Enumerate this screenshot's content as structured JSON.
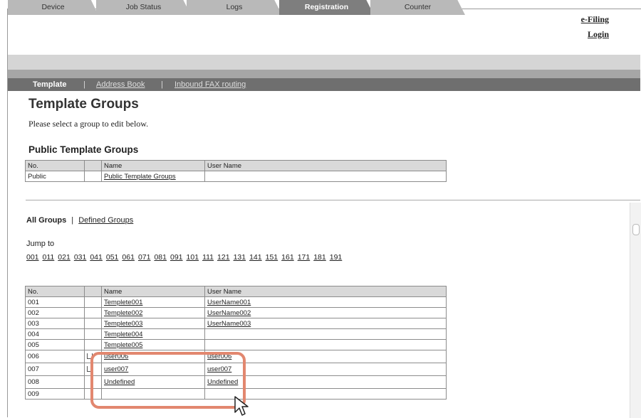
{
  "header": {
    "efiling_label": "e-Filing",
    "login_label": "Login"
  },
  "tabs": [
    {
      "label": "Device",
      "active": false
    },
    {
      "label": "Job Status",
      "active": false
    },
    {
      "label": "Logs",
      "active": false
    },
    {
      "label": "Registration",
      "active": true
    },
    {
      "label": "Counter",
      "active": false
    }
  ],
  "subnav": {
    "current": "Template",
    "sep": "|",
    "items": [
      "Address Book",
      "Inbound FAX routing"
    ]
  },
  "page": {
    "title": "Template Groups",
    "intro": "Please select a group to edit below.",
    "public_heading": "Public Template Groups"
  },
  "public_table": {
    "headers": [
      "No.",
      "",
      "Name",
      "User Name"
    ],
    "rows": [
      [
        "Public",
        "",
        "Public Template Groups",
        ""
      ]
    ]
  },
  "group_filter": {
    "all": "All Groups",
    "sep": "|",
    "defined": "Defined Groups"
  },
  "jump": {
    "label": "Jump to",
    "pages": [
      "001",
      "011",
      "021",
      "031",
      "041",
      "051",
      "061",
      "071",
      "081",
      "091",
      "101",
      "111",
      "121",
      "131",
      "141",
      "151",
      "161",
      "171",
      "181",
      "191"
    ]
  },
  "groups_table": {
    "headers": [
      "No.",
      "",
      "Name",
      "User Name"
    ],
    "rows": [
      [
        "001",
        "",
        "Templete001",
        "UserName001"
      ],
      [
        "002",
        "",
        "Templete002",
        "UserName002"
      ],
      [
        "003",
        "",
        "Templete003",
        "UserName003"
      ],
      [
        "004",
        "",
        "Templete004",
        ""
      ],
      [
        "005",
        "",
        "Templete005",
        ""
      ],
      [
        "006",
        "lock",
        "user006",
        "user006"
      ],
      [
        "007",
        "lock",
        "user007",
        "user007"
      ],
      [
        "008",
        "",
        "Undefined",
        "Undefined"
      ],
      [
        "009",
        "",
        "",
        ""
      ]
    ]
  },
  "colors": {
    "highlight": "#e2876f",
    "tab_active": "#7e7e7e",
    "tab_inactive": "#b9b9b9"
  }
}
